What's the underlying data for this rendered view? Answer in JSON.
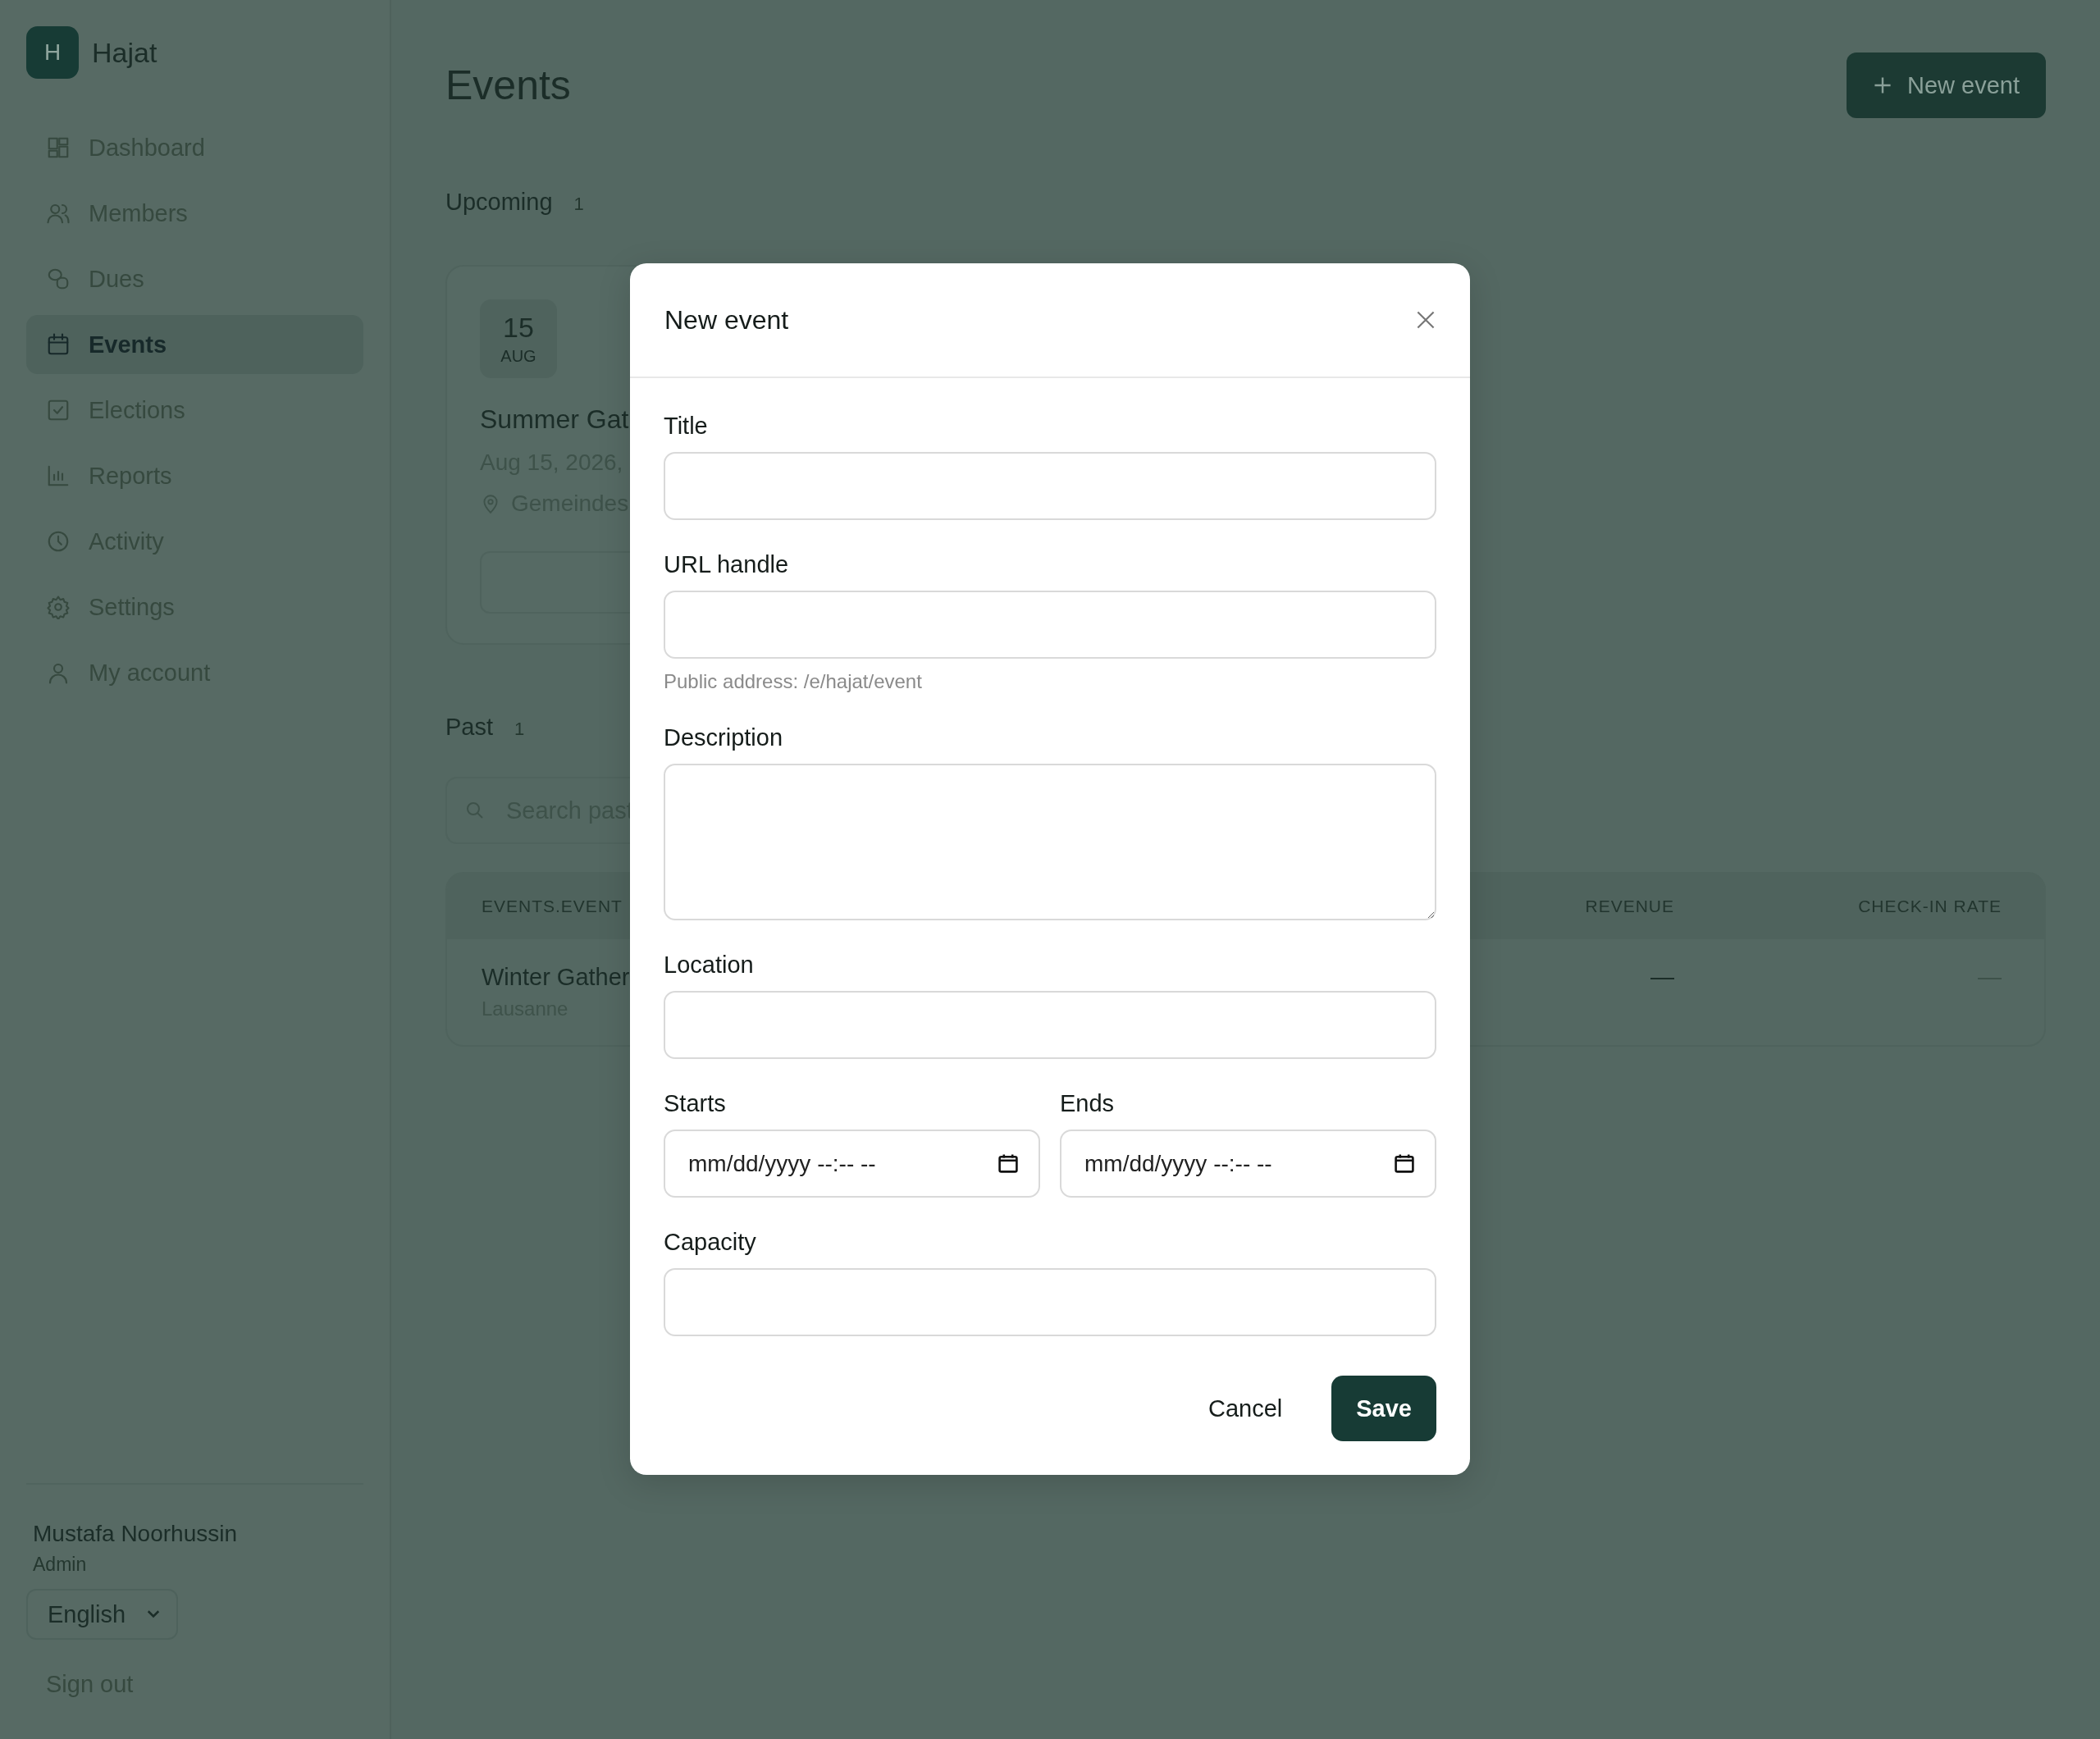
{
  "sidebar": {
    "logo": {
      "letter": "H",
      "name": "Hajat"
    },
    "items": [
      {
        "label": "Dashboard",
        "selected": false
      },
      {
        "label": "Members",
        "selected": false
      },
      {
        "label": "Dues",
        "selected": false
      },
      {
        "label": "Events",
        "selected": true
      },
      {
        "label": "Elections",
        "selected": false
      },
      {
        "label": "Reports",
        "selected": false
      },
      {
        "label": "Activity",
        "selected": false
      },
      {
        "label": "Settings",
        "selected": false
      },
      {
        "label": "My account",
        "selected": false
      }
    ],
    "user": {
      "name": "Mustafa Noorhussin",
      "role": "Admin"
    },
    "language": "English",
    "sign_out": "Sign out"
  },
  "page": {
    "title": "Events",
    "new_button": "New event",
    "upcoming": {
      "heading": "Upcoming",
      "count": "1",
      "cards": [
        {
          "day": "15",
          "month": "AUG",
          "title": "Summer Gat",
          "date": "Aug 15, 2026,",
          "location": "Gemeindes"
        }
      ]
    },
    "past": {
      "heading": "Past",
      "count": "1",
      "search": {
        "placeholder": "Search past"
      },
      "table": {
        "columns": [
          "EVENTS.EVENT",
          "REVENUE",
          "CHECK-IN RATE"
        ],
        "rows": [
          {
            "name": "Winter Gather",
            "place": "Lausanne",
            "revenue": "—",
            "check_in_rate": "—"
          }
        ]
      }
    }
  },
  "dialog": {
    "title": "New event",
    "fields": [
      {
        "kind": "text",
        "label": "Title"
      },
      {
        "kind": "text",
        "label": "URL handle",
        "hint": "Public address: /e/hajat/event"
      },
      {
        "kind": "textarea",
        "label": "Description"
      },
      {
        "kind": "text",
        "label": "Location"
      },
      {
        "kind": "datetime-pair",
        "items": [
          {
            "label": "Starts",
            "placeholder": "mm/dd/yyyy --:-- --"
          },
          {
            "label": "Ends",
            "placeholder": "mm/dd/yyyy --:-- --"
          }
        ]
      },
      {
        "kind": "text",
        "label": "Capacity"
      }
    ],
    "buttons": [
      {
        "kind": "plain",
        "label": "Cancel"
      },
      {
        "kind": "primary",
        "label": "Save"
      }
    ]
  }
}
